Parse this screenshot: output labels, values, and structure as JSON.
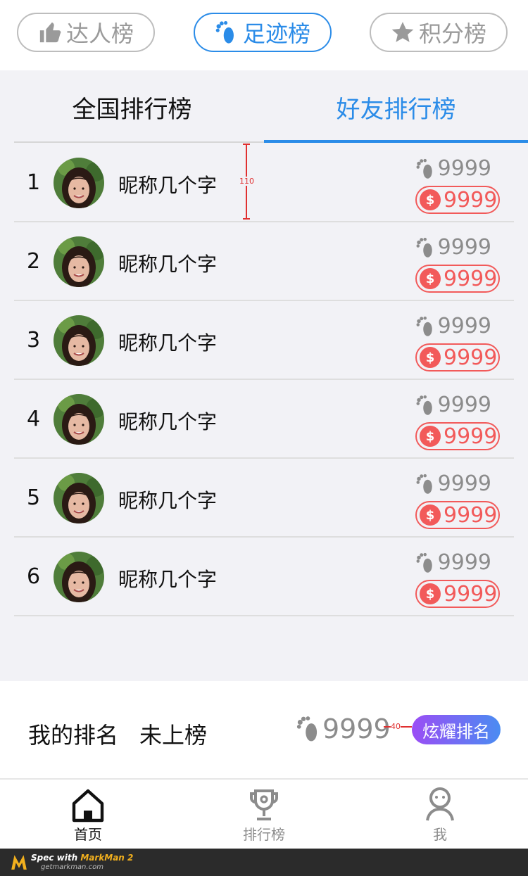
{
  "top_tabs": [
    {
      "label": "达人榜",
      "icon": "thumb-icon"
    },
    {
      "label": "足迹榜",
      "icon": "foot-icon"
    },
    {
      "label": "积分榜",
      "icon": "star-icon"
    }
  ],
  "sub_tabs": [
    "全国排行榜",
    "好友排行榜"
  ],
  "spec_row_height": "110",
  "list": [
    {
      "rank": "1",
      "nick": "昵称几个字",
      "steps": "9999",
      "coins": "9999"
    },
    {
      "rank": "2",
      "nick": "昵称几个字",
      "steps": "9999",
      "coins": "9999"
    },
    {
      "rank": "3",
      "nick": "昵称几个字",
      "steps": "9999",
      "coins": "9999"
    },
    {
      "rank": "4",
      "nick": "昵称几个字",
      "steps": "9999",
      "coins": "9999"
    },
    {
      "rank": "5",
      "nick": "昵称几个字",
      "steps": "9999",
      "coins": "9999"
    },
    {
      "rank": "6",
      "nick": "昵称几个字",
      "steps": "9999",
      "coins": "9999"
    }
  ],
  "coin_symbol": "$",
  "my_rank": {
    "label": "我的排名",
    "status": "未上榜",
    "steps": "9999",
    "spec_gap": "40",
    "button": "炫耀排名"
  },
  "nav": [
    {
      "label": "首页",
      "icon": "home-icon"
    },
    {
      "label": "排行榜",
      "icon": "trophy-icon"
    },
    {
      "label": "我",
      "icon": "user-icon"
    }
  ],
  "footer": {
    "title_prefix": "Spec with ",
    "title_brand": "MarkMan 2",
    "url": "getmarkman.com"
  },
  "colors": {
    "accent": "#2b8ce8",
    "coin": "#f25a5a",
    "gradient_start": "#9b4df5",
    "gradient_end": "#4a8cf2"
  }
}
